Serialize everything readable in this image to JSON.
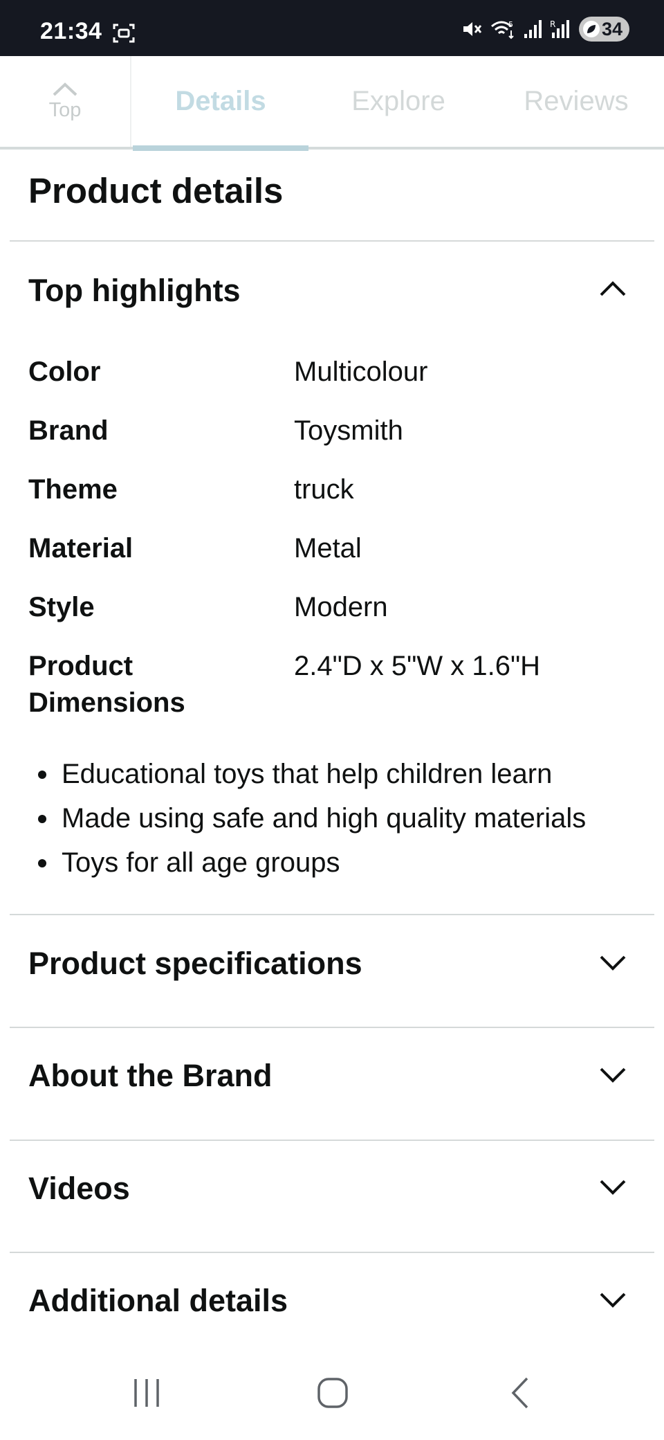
{
  "status_bar": {
    "time": "21:34",
    "battery_level": "34",
    "icons": [
      "screenshot-icon",
      "mute-icon",
      "wifi-icon",
      "signal-icon",
      "roaming-signal-icon",
      "battery-saver-icon"
    ]
  },
  "tabs": {
    "top_label": "Top",
    "items": [
      {
        "label": "Details",
        "active": true
      },
      {
        "label": "Explore",
        "active": false
      },
      {
        "label": "Reviews",
        "active": false
      }
    ]
  },
  "page_title": "Product details",
  "top_highlights": {
    "title": "Top highlights",
    "expanded": true,
    "specs": [
      {
        "label": "Color",
        "value": "Multicolour"
      },
      {
        "label": "Brand",
        "value": "Toysmith"
      },
      {
        "label": "Theme",
        "value": "truck"
      },
      {
        "label": "Material",
        "value": "Metal"
      },
      {
        "label": "Style",
        "value": "Modern"
      },
      {
        "label": "Product Dimensions",
        "value": "2.4\"D x 5\"W x 1.6\"H"
      }
    ],
    "bullets": [
      "Educational toys that help children learn",
      "Made using safe and high quality materials",
      "Toys for all age groups"
    ]
  },
  "sections": [
    {
      "title": "Product specifications",
      "expanded": false
    },
    {
      "title": "About the Brand",
      "expanded": false
    },
    {
      "title": "Videos",
      "expanded": false
    },
    {
      "title": "Additional details",
      "expanded": false
    }
  ],
  "colors": {
    "status_bar_bg": "#151821",
    "text": "#0f1111",
    "active_tab": "#c2dbe3",
    "divider": "#d5d9d9"
  }
}
